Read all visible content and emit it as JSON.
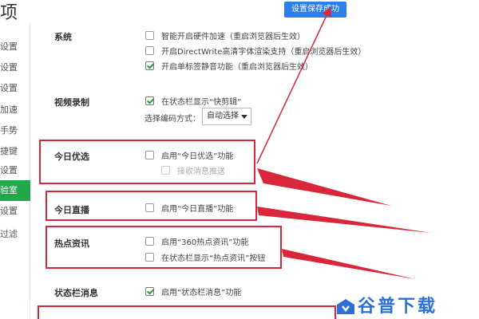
{
  "page": {
    "title": "项"
  },
  "toast": {
    "text": "设置保存成功"
  },
  "sidebar": {
    "items": [
      {
        "label": "设置"
      },
      {
        "label": "设置"
      },
      {
        "label": "设置"
      },
      {
        "label": "加速"
      },
      {
        "label": "手势"
      },
      {
        "label": "捷键"
      },
      {
        "label": "设置"
      },
      {
        "label": "验室"
      },
      {
        "label": "设置"
      },
      {
        "label": "过滤"
      }
    ],
    "active_index": 7
  },
  "sections": {
    "system": {
      "title": "系统",
      "options": [
        {
          "label": "智能开启硬件加速（重启浏览器后生效）",
          "checked": false
        },
        {
          "label": "开启DirectWrite高清字体渲染支持（重启浏览器后生效）",
          "checked": false
        },
        {
          "label": "开启单标签静音功能（重启浏览器后生效）",
          "checked": true
        }
      ]
    },
    "video": {
      "title": "视频录制",
      "options": [
        {
          "label": "在状态栏显示“快剪辑”",
          "checked": true
        }
      ],
      "encode_label": "选择编码方式：",
      "encode_value": "自动选择"
    },
    "today_pick": {
      "title": "今日优选",
      "options": [
        {
          "label": "启用“今日优选”功能",
          "checked": false
        },
        {
          "label": "接收消息推送",
          "checked": false,
          "disabled": true
        }
      ]
    },
    "today_live": {
      "title": "今日直播",
      "options": [
        {
          "label": "启用“今日直播”功能",
          "checked": false
        }
      ]
    },
    "hot_news": {
      "title": "热点资讯",
      "options": [
        {
          "label": "启用“360热点资讯”功能",
          "checked": false
        },
        {
          "label": "在状态栏显示“热点资讯”按钮",
          "checked": false
        }
      ]
    },
    "statusbar": {
      "title": "状态栏消息",
      "options": [
        {
          "label": "启用“状态栏消息”功能",
          "checked": true
        }
      ]
    }
  },
  "watermark": {
    "text": "谷普下载"
  },
  "colors": {
    "accent_green": "#22a84a",
    "toast_blue": "#2c7ee8",
    "highlight_red": "#d9263a"
  }
}
